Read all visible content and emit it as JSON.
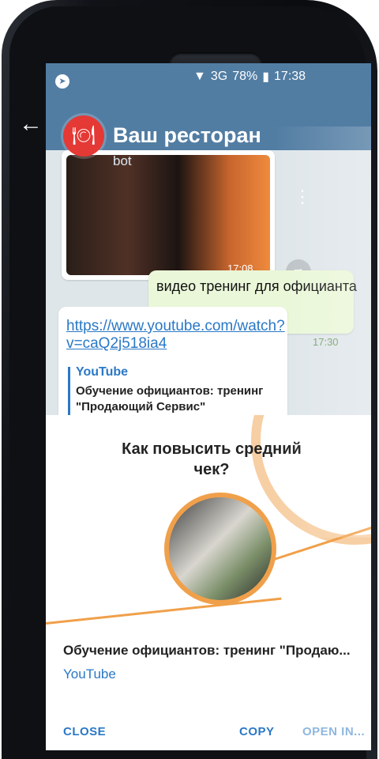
{
  "statusbar": {
    "network": "3G",
    "battery": "78%",
    "time": "17:38"
  },
  "header": {
    "title": "Ваш ресторан",
    "subtitle": "bot"
  },
  "messages": {
    "video_time": "17:08",
    "outgoing_text": "видео тренинг для официанта",
    "outgoing_time": "17:30",
    "link": "https://www.youtube.com/watch?v=caQ2j518ia4",
    "preview_site": "YouTube",
    "preview_title": "Обучение официантов: тренинг \"Продающий Сервис\""
  },
  "sheet": {
    "image_text": "Как повысить средний чек?",
    "title": "Обучение официантов: тренинг \"Продаю...",
    "site": "YouTube"
  },
  "actions": {
    "close": "CLOSE",
    "copy": "COPY",
    "open": "OPEN IN..."
  },
  "colors": {
    "header": "#527da3",
    "link": "#2a78c6",
    "accent": "#f0a04a",
    "outgoing_bubble": "#eaf7d8"
  },
  "icons": {
    "back": "arrow-back-icon",
    "more": "more-vertical-icon",
    "share": "share-icon",
    "avatar": "restaurant-avatar-icon",
    "notification": "telegram-notification-icon"
  }
}
